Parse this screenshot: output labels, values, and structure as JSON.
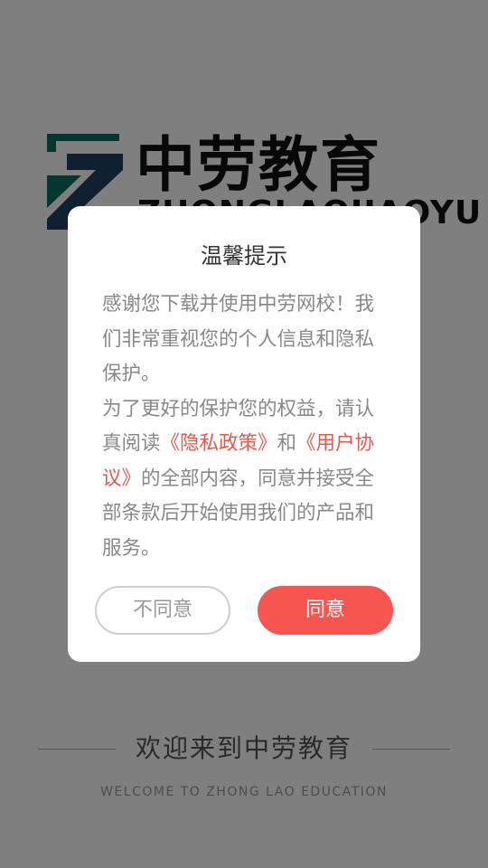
{
  "logo": {
    "brand_name": "中劳教育",
    "brand_pinyin": "ZHONGLAOJIAOYU",
    "mark_colors": [
      "#0a6f62",
      "#1f4060"
    ]
  },
  "welcome": {
    "title": "欢迎来到中劳教育",
    "subtitle": "WELCOME TO ZHONG LAO EDUCATION"
  },
  "dialog": {
    "title": "温馨提示",
    "para1": "感谢您下载并使用中劳网校！我们非常重视您的个人信息和隐私保护。",
    "para2_part1": "为了更好的保护您的权益，请认真阅读",
    "privacy_link": "《隐私政策》",
    "para2_and": "和",
    "user_agreement_link": "《用户协议》",
    "para2_part2": "的全部内容，同意并接受全部条款后开始使用我们的产品和服务。",
    "disagree_label": "不同意",
    "agree_label": "同意"
  },
  "colors": {
    "accent": "#f6564f",
    "link": "#e8584a",
    "overlay": "rgba(0,0,0,0.5)"
  }
}
